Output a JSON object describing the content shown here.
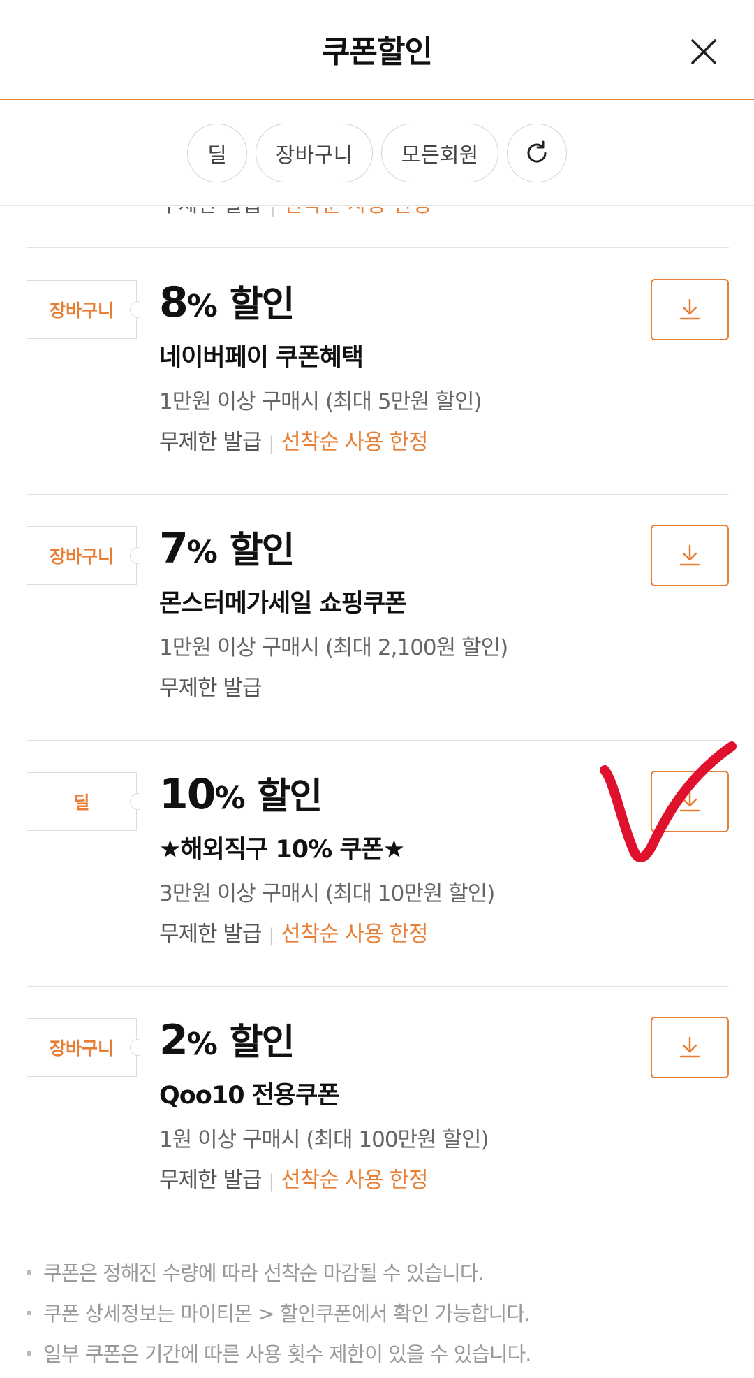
{
  "header": {
    "title": "쿠폰할인",
    "close_icon": "close-icon"
  },
  "filters": [
    {
      "label": "딜"
    },
    {
      "label": "장바구니"
    },
    {
      "label": "모든회원"
    }
  ],
  "refresh_icon": "refresh-icon",
  "partial_row": {
    "prefix": "무제한 발급",
    "highlight": "선착순 사용 한정"
  },
  "coupons": [
    {
      "tag": "장바구니",
      "amount": "8",
      "unit": "%",
      "suffix": "할인",
      "name": "네이버페이 쿠폰혜택",
      "condition": "1만원 이상 구매시 (최대 5만원 할인)",
      "issue": "무제한 발급",
      "limit": "선착순 사용 한정"
    },
    {
      "tag": "장바구니",
      "amount": "7",
      "unit": "%",
      "suffix": "할인",
      "name": "몬스터메가세일 쇼핑쿠폰",
      "condition": "1만원 이상 구매시 (최대 2,100원 할인)",
      "issue": "무제한 발급",
      "limit": ""
    },
    {
      "tag": "딜",
      "amount": "10",
      "unit": "%",
      "suffix": "할인",
      "name": "★해외직구 10% 쿠폰★",
      "condition": "3만원 이상 구매시 (최대 10만원 할인)",
      "issue": "무제한 발급",
      "limit": "선착순 사용 한정"
    },
    {
      "tag": "장바구니",
      "amount": "2",
      "unit": "%",
      "suffix": "할인",
      "name": "Qoo10 전용쿠폰",
      "condition": "1원 이상 구매시 (최대 100만원 할인)",
      "issue": "무제한 발급",
      "limit": "선착순 사용 한정"
    }
  ],
  "notes": [
    "쿠폰은 정해진 수량에 따라 선착순 마감될 수 있습니다.",
    "쿠폰 상세정보는 마이티몬 > 할인쿠폰에서 확인 가능합니다.",
    "일부 쿠폰은 기간에 따른 사용 횟수 제한이 있을 수 있습니다."
  ],
  "colors": {
    "accent": "#e87d34",
    "check_mark": "#e0112d"
  }
}
